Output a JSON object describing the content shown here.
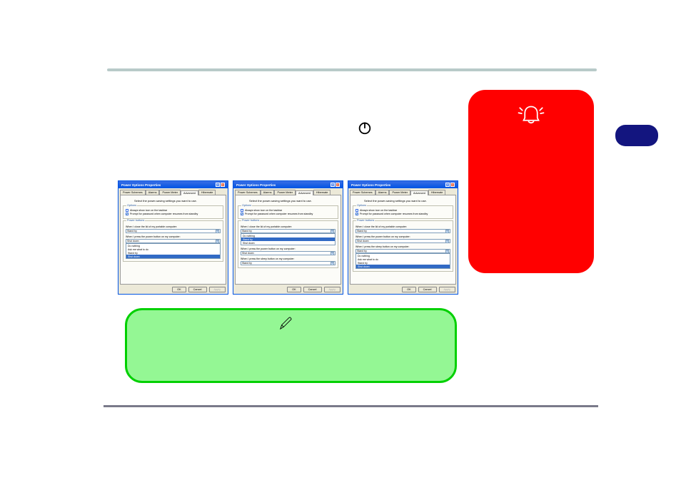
{
  "dialogs": {
    "title": "Power Options Properties",
    "tabs": [
      "Power Schemes",
      "Alarms",
      "Power Meter",
      "Advanced",
      "Hibernate"
    ],
    "activeTab": "Advanced",
    "instruction": "Select the power-saving settings you want to use.",
    "optionsGroup": "Options",
    "chkTaskbar": "Always show icon on the taskbar",
    "chkPassword": "Prompt for password when computer resumes from standby",
    "powerGroup": "Power buttons",
    "label_lid": "When I close the lid of my portable computer:",
    "val_lid_standby": "Stand by",
    "label_power": "When I press the power button on my computer:",
    "val_power_shutdown": "Shut down",
    "label_sleep": "When I press the sleep button on my computer:",
    "val_sleep_standby": "Stand by",
    "opts_lid": [
      "Do nothing",
      "Stand by",
      "Shut down"
    ],
    "opts_power1": [
      "Do nothing",
      "Ask me what to do",
      "Stand by",
      "Shut down"
    ],
    "opts_sleep": [
      "Do nothing",
      "Ask me what to do",
      "Stand by",
      "Shut down"
    ],
    "ok": "OK",
    "cancel": "Cancel",
    "apply": "Apply"
  }
}
